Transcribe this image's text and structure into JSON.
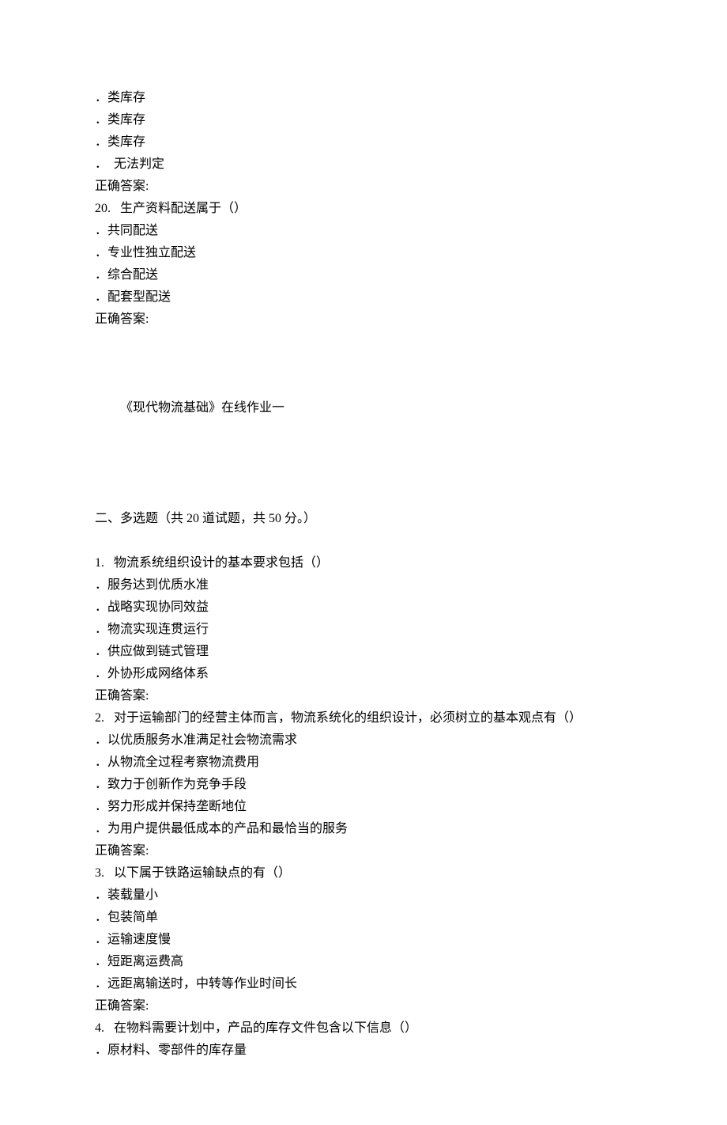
{
  "lines": [
    {
      "text": "．类库存",
      "indent": 0
    },
    {
      "text": "．类库存",
      "indent": 0
    },
    {
      "text": "．类库存",
      "indent": 0
    },
    {
      "text": "．  无法判定",
      "indent": 0
    },
    {
      "text": "正确答案:",
      "indent": 0
    },
    {
      "text": "20.   生产资料配送属于（）",
      "indent": 0
    },
    {
      "text": "．共同配送",
      "indent": 0
    },
    {
      "text": "．专业性独立配送",
      "indent": 0
    },
    {
      "text": "．综合配送",
      "indent": 0
    },
    {
      "text": "．配套型配送",
      "indent": 0
    },
    {
      "text": "正确答案:",
      "indent": 0
    },
    {
      "text": "",
      "indent": 0
    },
    {
      "text": "",
      "indent": 0
    },
    {
      "text": "",
      "indent": 0
    },
    {
      "text": "《现代物流基础》在线作业一",
      "indent": 1
    },
    {
      "text": "",
      "indent": 0
    },
    {
      "text": "",
      "indent": 0
    },
    {
      "text": "",
      "indent": 0
    },
    {
      "text": "",
      "indent": 0
    },
    {
      "text": "二、多选题（共 20 道试题，共 50 分。）",
      "indent": 0
    },
    {
      "text": "",
      "indent": 0
    },
    {
      "text": "1.   物流系统组织设计的基本要求包括（）",
      "indent": 0
    },
    {
      "text": "．服务达到优质水准",
      "indent": 0
    },
    {
      "text": "．战略实现协同效益",
      "indent": 0
    },
    {
      "text": "．物流实现连贯运行",
      "indent": 0
    },
    {
      "text": "．供应做到链式管理",
      "indent": 0
    },
    {
      "text": "．外协形成网络体系",
      "indent": 0
    },
    {
      "text": "正确答案:",
      "indent": 0
    },
    {
      "text": "2.   对于运输部门的经营主体而言，物流系统化的组织设计，必须树立的基本观点有（）",
      "indent": 0
    },
    {
      "text": "．以优质服务水准满足社会物流需求",
      "indent": 0
    },
    {
      "text": "．从物流全过程考察物流费用",
      "indent": 0
    },
    {
      "text": "．致力于创新作为竞争手段",
      "indent": 0
    },
    {
      "text": "．努力形成并保持垄断地位",
      "indent": 0
    },
    {
      "text": "．为用户提供最低成本的产品和最恰当的服务",
      "indent": 0
    },
    {
      "text": "正确答案:",
      "indent": 0
    },
    {
      "text": "3.   以下属于铁路运输缺点的有（）",
      "indent": 0
    },
    {
      "text": "．装载量小",
      "indent": 0
    },
    {
      "text": "．包装简单",
      "indent": 0
    },
    {
      "text": "．运输速度慢",
      "indent": 0
    },
    {
      "text": "．短距离运费高",
      "indent": 0
    },
    {
      "text": "．远距离输送时，中转等作业时间长",
      "indent": 0
    },
    {
      "text": "正确答案:",
      "indent": 0
    },
    {
      "text": "4.   在物料需要计划中，产品的库存文件包含以下信息（）",
      "indent": 0
    },
    {
      "text": "．原材料、零部件的库存量",
      "indent": 0
    }
  ]
}
